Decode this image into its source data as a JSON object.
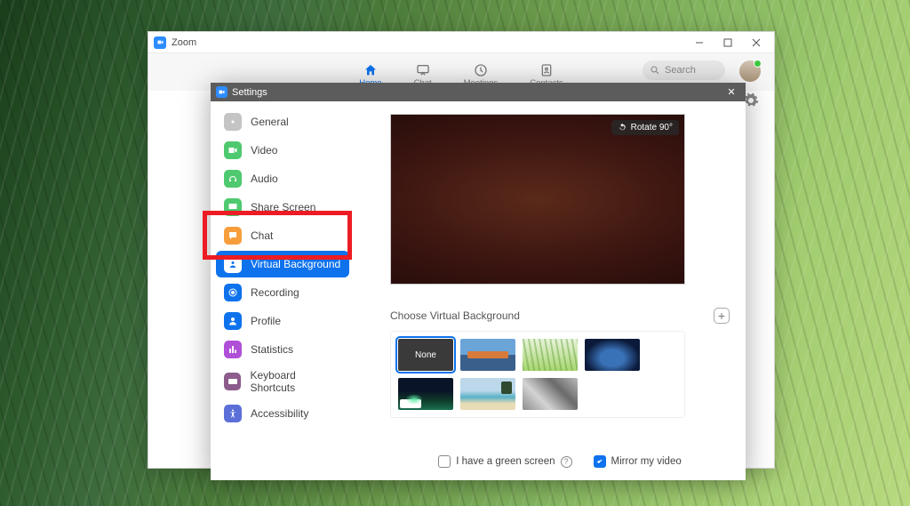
{
  "app": {
    "title": "Zoom"
  },
  "nav": {
    "tabs": [
      {
        "id": "home",
        "label": "Home"
      },
      {
        "id": "chat",
        "label": "Chat"
      },
      {
        "id": "meetings",
        "label": "Meetings"
      },
      {
        "id": "contacts",
        "label": "Contacts"
      }
    ],
    "search_placeholder": "Search"
  },
  "settings": {
    "title": "Settings",
    "items": [
      {
        "id": "general",
        "label": "General"
      },
      {
        "id": "video",
        "label": "Video"
      },
      {
        "id": "audio",
        "label": "Audio"
      },
      {
        "id": "share",
        "label": "Share Screen"
      },
      {
        "id": "chat",
        "label": "Chat"
      },
      {
        "id": "vb",
        "label": "Virtual Background"
      },
      {
        "id": "rec",
        "label": "Recording"
      },
      {
        "id": "profile",
        "label": "Profile"
      },
      {
        "id": "stats",
        "label": "Statistics"
      },
      {
        "id": "keys",
        "label": "Keyboard Shortcuts"
      },
      {
        "id": "a11y",
        "label": "Accessibility"
      }
    ]
  },
  "vb": {
    "rotate_label": "Rotate 90°",
    "section_title": "Choose Virtual Background",
    "none_label": "None",
    "green_screen_label": "I have a green screen",
    "mirror_label": "Mirror my video"
  }
}
